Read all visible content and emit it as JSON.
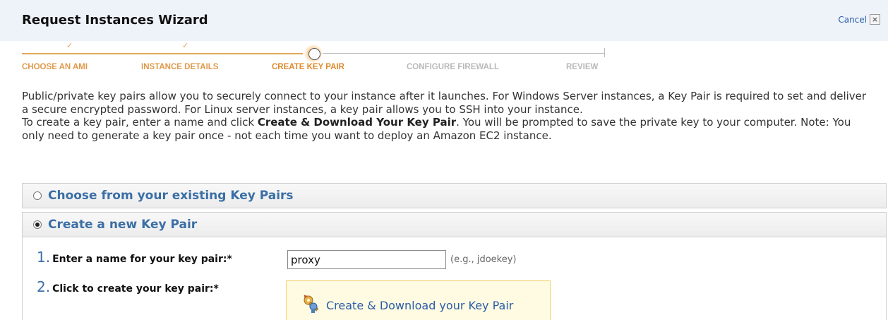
{
  "wizard": {
    "title": "Request Instances Wizard",
    "cancel_label": "Cancel",
    "close_glyph": "×"
  },
  "steps": [
    {
      "label": "CHOOSE AN AMI",
      "state": "done"
    },
    {
      "label": "INSTANCE DETAILS",
      "state": "done"
    },
    {
      "label": "CREATE KEY PAIR",
      "state": "current"
    },
    {
      "label": "CONFIGURE FIREWALL",
      "state": "todo"
    },
    {
      "label": "REVIEW",
      "state": "todo"
    }
  ],
  "check_glyph": "✓",
  "description": {
    "para1": "Public/private key pairs allow you to securely connect to your instance after it launches. For Windows Server instances, a Key Pair is required to set and deliver a secure encrypted password. For Linux server instances, a key pair allows you to SSH into your instance.",
    "para2_prefix": "To create a key pair, enter a name and click ",
    "para2_bold": "Create & Download Your Key Pair",
    "para2_suffix": ". You will be prompted to save the private key to your computer. Note: You only need to generate a key pair once - not each time you want to deploy an Amazon EC2 instance."
  },
  "options": {
    "existing_label": "Choose from your existing Key Pairs",
    "new_label": "Create a new Key Pair",
    "selected": "new"
  },
  "form": {
    "step1_number": "1.",
    "step1_label": "Enter a name for your key pair:*",
    "key_name_value": "proxy",
    "key_name_hint": "(e.g., jdoekey)",
    "step2_number": "2.",
    "step2_label": "Click to create your key pair:*",
    "create_button_label": "Create & Download your Key Pair",
    "create_icon": "key-pair-icon"
  },
  "colors": {
    "header_bg": "#eef3fa",
    "link": "#2a5ca8",
    "panel_title": "#3a6ea5",
    "step_done": "#e09a4c",
    "step_todo": "#b9b9b9",
    "create_box_bg": "#fffbe2"
  }
}
